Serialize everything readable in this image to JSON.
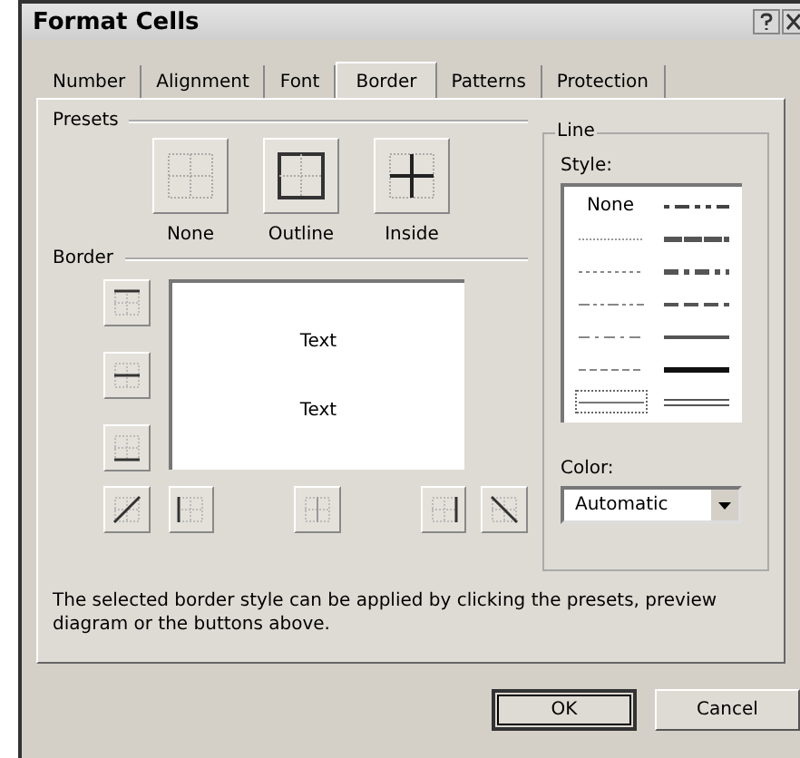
{
  "window": {
    "title": "Format Cells"
  },
  "tabs": [
    {
      "label": "Number",
      "selected": false
    },
    {
      "label": "Alignment",
      "selected": false
    },
    {
      "label": "Font",
      "selected": false
    },
    {
      "label": "Border",
      "selected": true
    },
    {
      "label": "Patterns",
      "selected": false
    },
    {
      "label": "Protection",
      "selected": false
    }
  ],
  "presets": {
    "title": "Presets",
    "items": [
      {
        "kind": "none",
        "label": "None"
      },
      {
        "kind": "outline",
        "label": "Outline"
      },
      {
        "kind": "inside",
        "label": "Inside"
      }
    ]
  },
  "border": {
    "title": "Border",
    "preview_texts": [
      "Text",
      "Text"
    ],
    "side_buttons": [
      {
        "kind": "top"
      },
      {
        "kind": "middle"
      },
      {
        "kind": "bottom"
      }
    ],
    "bottom_buttons": [
      {
        "kind": "diag-up"
      },
      {
        "kind": "left"
      },
      {
        "kind": "center"
      },
      {
        "kind": "right"
      },
      {
        "kind": "diag-down"
      }
    ]
  },
  "line": {
    "title": "Line",
    "style_label": "Style:",
    "styles": [
      {
        "kind": "none",
        "label": "None",
        "selected": false
      },
      {
        "kind": "hair",
        "selected": false
      },
      {
        "kind": "dotted",
        "selected": false
      },
      {
        "kind": "dashdotdot",
        "selected": false
      },
      {
        "kind": "dashdot",
        "selected": false
      },
      {
        "kind": "dashed",
        "selected": false
      },
      {
        "kind": "thin",
        "selected": true
      },
      {
        "kind": "mdashdotdot",
        "selected": false
      },
      {
        "kind": "slanted",
        "selected": false
      },
      {
        "kind": "mdashdot",
        "selected": false
      },
      {
        "kind": "mdashed",
        "selected": false
      },
      {
        "kind": "medium",
        "selected": false
      },
      {
        "kind": "thick",
        "selected": false
      },
      {
        "kind": "double",
        "selected": false
      }
    ],
    "color_label": "Color:",
    "color_value": "Automatic"
  },
  "hint": "The selected border style can be applied by clicking the presets, preview diagram or the buttons above.",
  "buttons": [
    {
      "label": "OK",
      "default": true
    },
    {
      "label": "Cancel",
      "default": false
    }
  ]
}
